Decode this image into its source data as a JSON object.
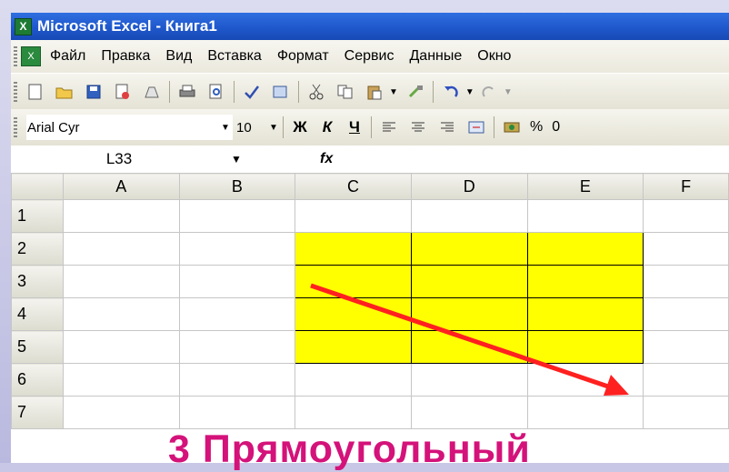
{
  "window": {
    "title": "Microsoft Excel - Книга1"
  },
  "menu": {
    "items": [
      "Файл",
      "Правка",
      "Вид",
      "Вставка",
      "Формат",
      "Сервис",
      "Данные",
      "Окно"
    ]
  },
  "toolbar": {
    "icons": [
      "new-icon",
      "open-icon",
      "save-icon",
      "permission-icon",
      "email-icon",
      "print-icon",
      "print-preview-icon",
      "spelling-icon",
      "research-icon",
      "cut-icon",
      "copy-icon",
      "paste-icon",
      "format-painter-icon",
      "undo-icon",
      "redo-icon"
    ]
  },
  "format": {
    "font": "Arial Cyr",
    "size": "10",
    "bold": "Ж",
    "italic": "К",
    "underline": "Ч",
    "percent": "%",
    "trailing": "0"
  },
  "namebox": {
    "value": "L33",
    "fx": "fx"
  },
  "sheet": {
    "columns": [
      "A",
      "B",
      "C",
      "D",
      "E",
      "F"
    ],
    "rows": [
      "1",
      "2",
      "3",
      "4",
      "5",
      "6",
      "7"
    ],
    "highlight": {
      "range_cols": [
        "C",
        "D",
        "E"
      ],
      "range_rows": [
        "2",
        "3",
        "4",
        "5"
      ],
      "color": "#ffff00"
    }
  },
  "arrow": {
    "color": "#ff2020"
  },
  "caption": {
    "text": "3 Прямоугольный"
  }
}
